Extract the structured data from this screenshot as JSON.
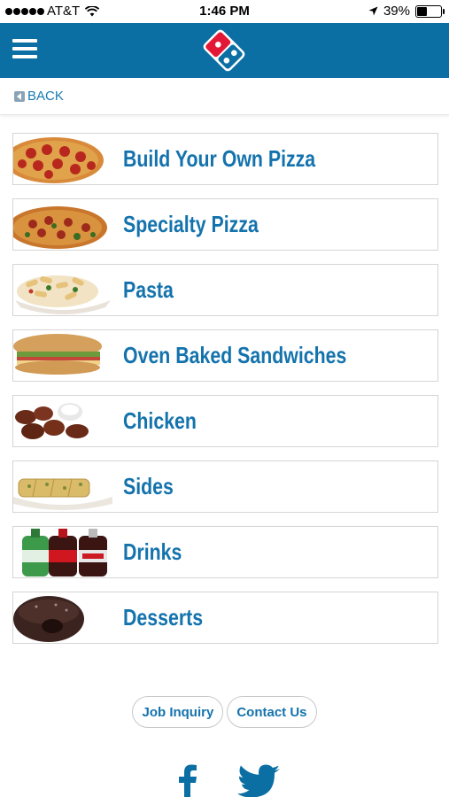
{
  "status_bar": {
    "carrier": "AT&T",
    "time": "1:46 PM",
    "battery_percent": "39%",
    "battery_level": 0.39,
    "icons": [
      "signal-dots",
      "wifi-icon",
      "location-arrow-icon",
      "battery-icon"
    ]
  },
  "nav": {
    "menu_icon": "hamburger-menu-icon",
    "logo": "dominos-logo",
    "brand_color": "#0b6fa4"
  },
  "back": {
    "label": "BACK"
  },
  "menu": {
    "items": [
      {
        "label": "Build Your Own Pizza",
        "image": "pepperoni-pizza"
      },
      {
        "label": "Specialty Pizza",
        "image": "specialty-pizza"
      },
      {
        "label": "Pasta",
        "image": "pasta-bowl"
      },
      {
        "label": "Oven Baked Sandwiches",
        "image": "sub-sandwich"
      },
      {
        "label": "Chicken",
        "image": "chicken-wings"
      },
      {
        "label": "Sides",
        "image": "bread-sticks"
      },
      {
        "label": "Drinks",
        "image": "soda-bottles"
      },
      {
        "label": "Desserts",
        "image": "lava-cake"
      }
    ],
    "label_color": "#1473ad"
  },
  "footer": {
    "job_inquiry": "Job Inquiry",
    "contact_us": "Contact Us",
    "social_icons": [
      "facebook-icon",
      "twitter-icon"
    ]
  }
}
